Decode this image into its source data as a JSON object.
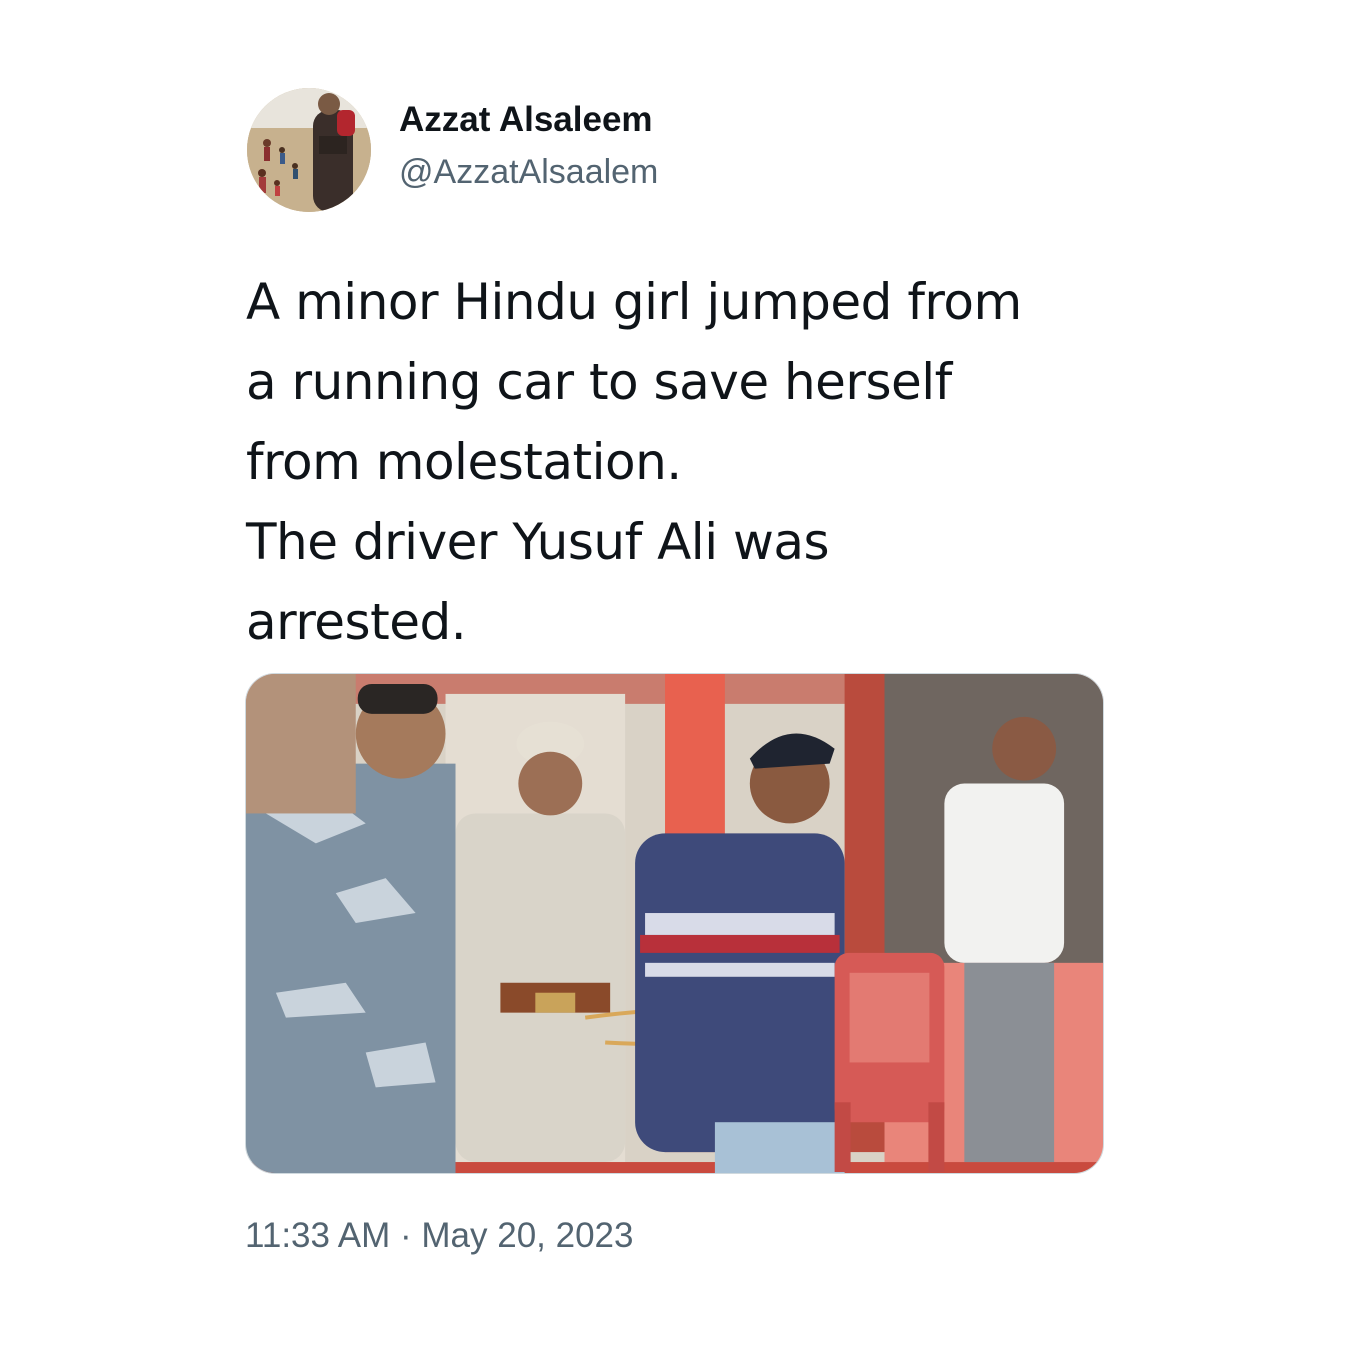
{
  "author": {
    "display_name": "Azzat Alsaleem",
    "handle": "@AzzatAlsaalem"
  },
  "tweet": {
    "text_lines": [
      "A minor Hindu girl jumped from",
      "a running car to save herself",
      "from molestation.",
      "The driver Yusuf Ali was",
      "arrested."
    ],
    "timestamp": "11:33 AM · May 20, 2023"
  },
  "colors": {
    "text_primary": "#0f1419",
    "text_secondary": "#536471",
    "border": "#cfd9de"
  }
}
